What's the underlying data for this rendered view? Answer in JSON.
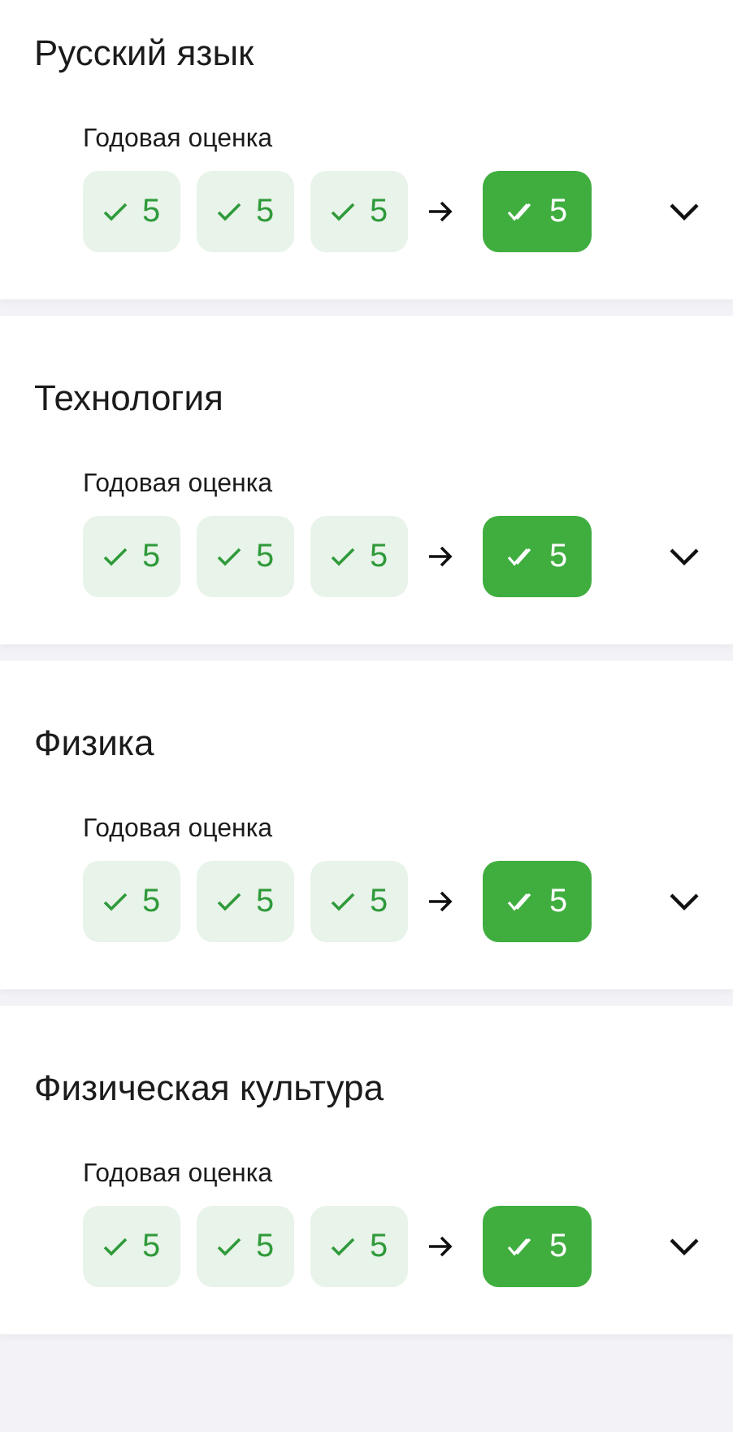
{
  "subjects": [
    {
      "title": "Русский язык",
      "label": "Годовая оценка",
      "marks": [
        "5",
        "5",
        "5"
      ],
      "final": "5",
      "expanded": false
    },
    {
      "title": "Технология",
      "label": "Годовая оценка",
      "marks": [
        "5",
        "5",
        "5"
      ],
      "final": "5",
      "expanded": false
    },
    {
      "title": "Физика",
      "label": "Годовая оценка",
      "marks": [
        "5",
        "5",
        "5"
      ],
      "final": "5",
      "expanded": false
    },
    {
      "title": "Физическая культура",
      "label": "Годовая оценка",
      "marks": [
        "5",
        "5",
        "5"
      ],
      "final": "5",
      "expanded": false
    }
  ]
}
